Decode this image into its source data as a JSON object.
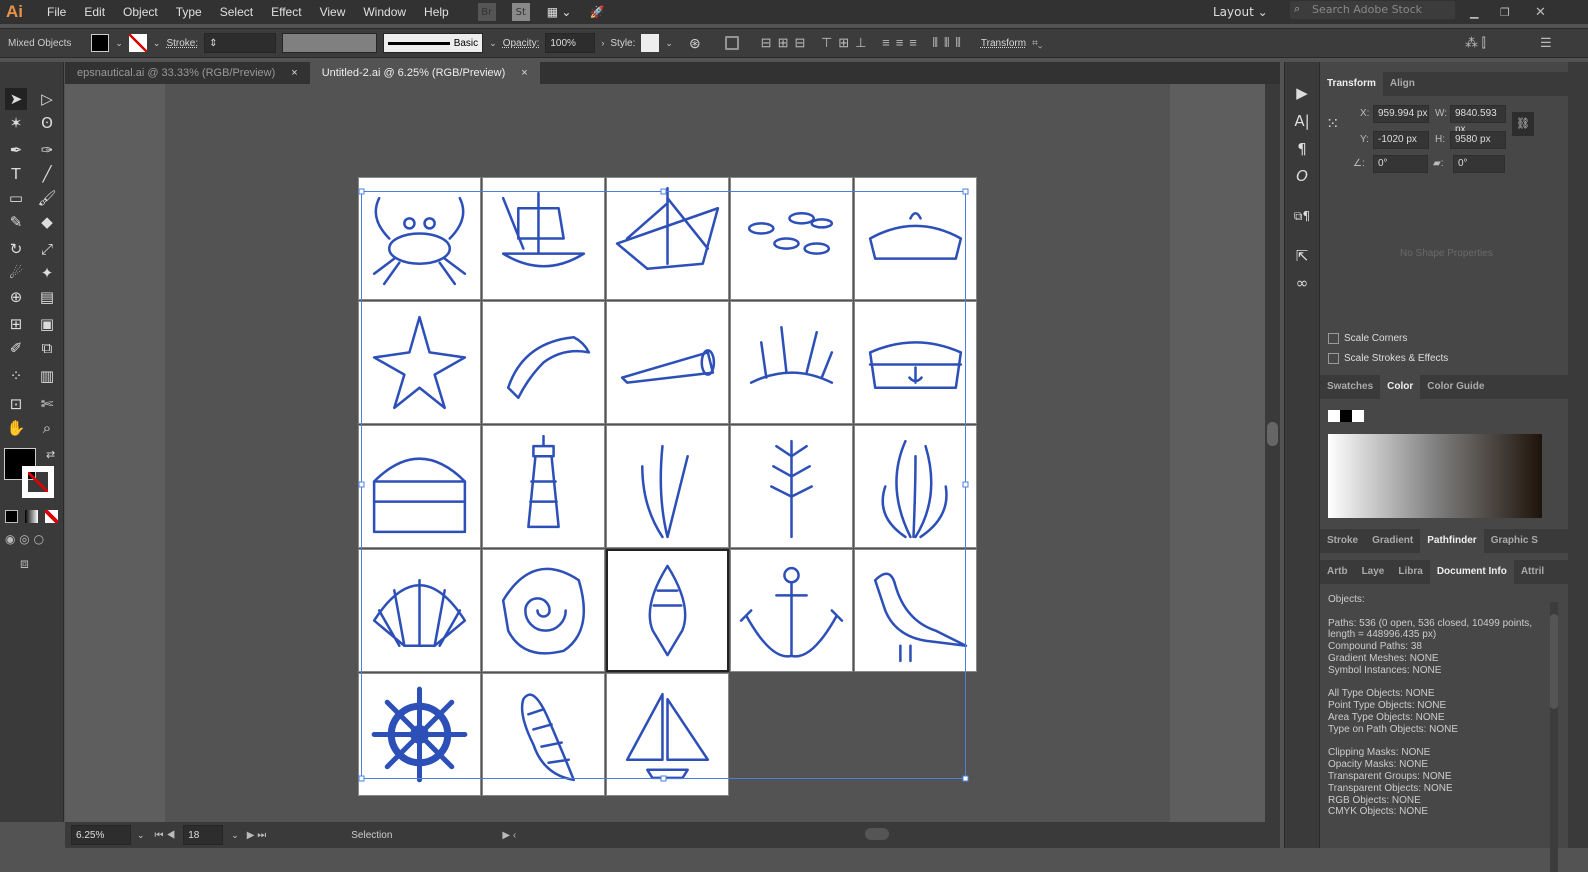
{
  "menubar": {
    "logo": "Ai",
    "items": [
      "File",
      "Edit",
      "Object",
      "Type",
      "Select",
      "Effect",
      "View",
      "Window",
      "Help"
    ],
    "bridge": "Br",
    "stock": "St",
    "workspace": "Layout",
    "search_placeholder": "Search Adobe Stock"
  },
  "control": {
    "selection_type": "Mixed Objects",
    "stroke_label": "Stroke:",
    "brush": "Basic",
    "opacity_label": "Opacity:",
    "opacity": "100%",
    "style_label": "Style:",
    "transform_label": "Transform"
  },
  "tabs": [
    {
      "label": "epsnautical.ai @ 33.33% (RGB/Preview)"
    },
    {
      "label": "Untitled-2.ai @ 6.25% (RGB/Preview)"
    }
  ],
  "close_glyph": "×",
  "status": {
    "zoom": "6.25%",
    "artboard": "18",
    "tool": "Selection"
  },
  "transform": {
    "tab": "Transform",
    "tab2": "Align",
    "x_label": "X:",
    "x": "959.994 px",
    "y_label": "Y:",
    "y": "-1020 px",
    "w_label": "W:",
    "w": "9840.593 px",
    "h_label": "H:",
    "h": "9580 px",
    "angle": "0°",
    "shear": "0°",
    "no_shape": "No Shape Properties",
    "scale_corners": "Scale Corners",
    "scale_strokes": "Scale Strokes & Effects"
  },
  "color_tabs": [
    "Swatches",
    "Color",
    "Color Guide"
  ],
  "pathfinder_tabs": [
    "Stroke",
    "Gradient",
    "Pathfinder",
    "Graphic S"
  ],
  "info_tabs": [
    "Artb",
    "Laye",
    "Libra",
    "Document Info",
    "Attril"
  ],
  "document_info": "Objects:\n\nPaths: 536 (0 open, 536 closed, 10499 points, length = 448996.435 px)\nCompound Paths: 38\nGradient Meshes: NONE\nSymbol Instances: NONE\n\nAll Type Objects: NONE\nPoint Type Objects: NONE\nArea Type Objects: NONE\nType on Path Objects: NONE\n\nClipping Masks: NONE\nOpacity Masks: NONE\nTransparent Groups: NONE\nTransparent Objects: NONE\nRGB Objects: NONE\nCMYK Objects: NONE",
  "artboards": [
    "crab",
    "ship",
    "sailboat",
    "fish",
    "sailor-hat",
    "starfish",
    "dolphin",
    "spyglass",
    "coral",
    "sailor-cap",
    "treasure-chest",
    "lighthouse",
    "seaweed",
    "leaf-branch",
    "kelp",
    "scallop-shell",
    "spiral-shell",
    "conch",
    "anchor",
    "seagull",
    "ship-wheel",
    "auger-shell",
    "small-sailboat"
  ],
  "colors": {
    "art": "#2d4fb8",
    "selection": "#4a7fe0",
    "accent": "#e8924a"
  }
}
